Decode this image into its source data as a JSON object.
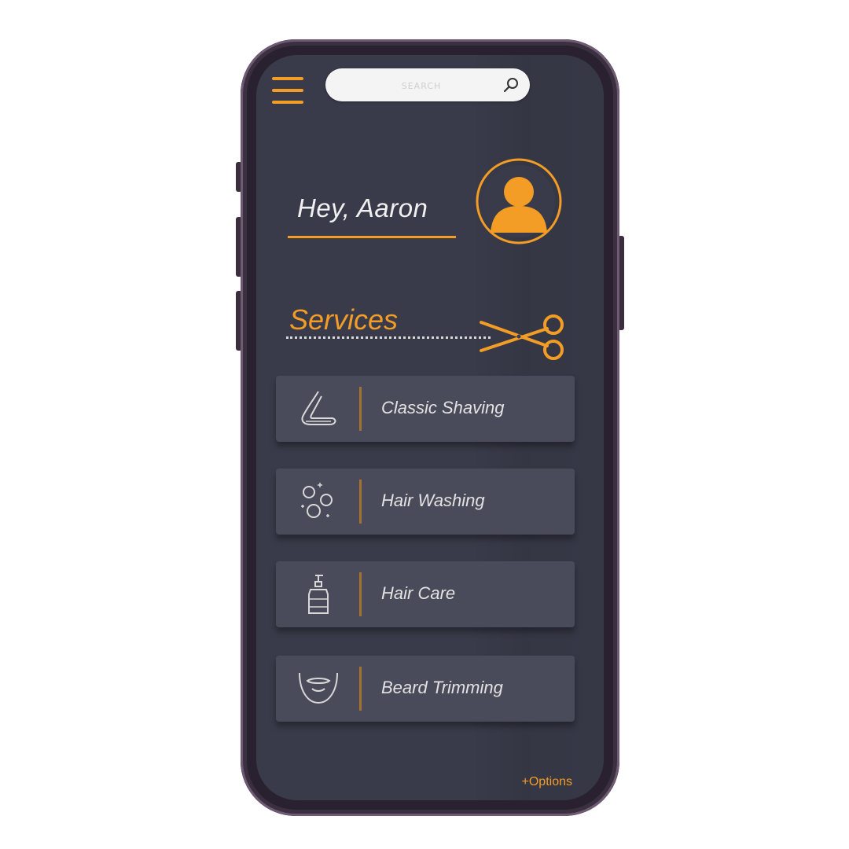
{
  "header": {
    "menu_icon": "hamburger-menu-icon",
    "search": {
      "placeholder": "SEARCH",
      "icon": "search-icon"
    }
  },
  "user": {
    "greeting": "Hey, Aaron",
    "avatar_icon": "user-avatar-icon"
  },
  "services": {
    "title": "Services",
    "title_icon": "scissors-icon",
    "items": [
      {
        "label": "Classic Shaving",
        "icon": "razor-icon"
      },
      {
        "label": "Hair Washing",
        "icon": "bubbles-icon"
      },
      {
        "label": "Hair Care",
        "icon": "pump-bottle-icon"
      },
      {
        "label": "Beard Trimming",
        "icon": "beard-icon"
      }
    ]
  },
  "footer": {
    "options_label": "+Options"
  },
  "colors": {
    "accent": "#f39c26",
    "screen_bg": "#393b4a",
    "card_bg": "#4a4b5a",
    "phone_frame": "#2a2130"
  }
}
